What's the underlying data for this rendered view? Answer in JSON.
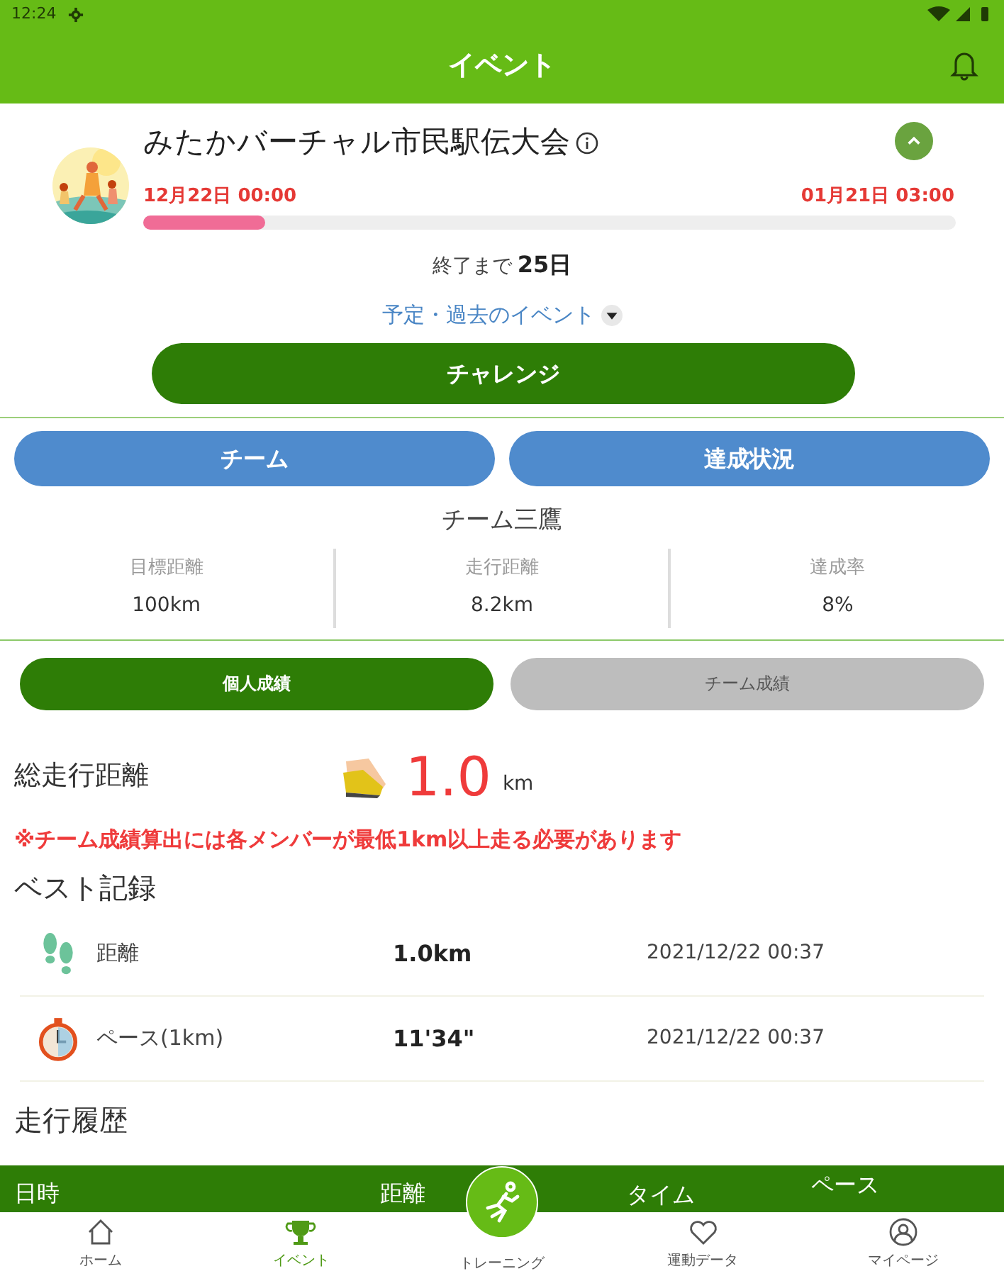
{
  "status_bar": {
    "time": "12:24"
  },
  "app_bar": {
    "title": "イベント"
  },
  "event": {
    "title": "みたかバーチャル市民駅伝大会",
    "expanded": true,
    "start": "12月22日 00:00",
    "end": "01月21日 03:00",
    "level": 0.15,
    "remaining_label": "終了まで",
    "remaining_value": "25日",
    "other_events": "予定・過去のイベント",
    "challenge": "チャレンジ"
  },
  "team_buttons": [
    "チーム",
    "達成状況"
  ],
  "team": {
    "name": "チーム三鷹",
    "stats": [
      {
        "label": "目標距離",
        "value": "100km"
      },
      {
        "label": "走行距離",
        "value": "8.2km"
      },
      {
        "label": "達成率",
        "value": "8%"
      }
    ]
  },
  "result_tabs": [
    {
      "label": "個人成績",
      "selected": true
    },
    {
      "label": "チーム成績",
      "selected": false
    }
  ],
  "total": {
    "label": "総走行距離",
    "value": "1.0",
    "unit": "km"
  },
  "note": "※チーム成績算出には各メンバーが最低1km以上走る必要があります",
  "best": {
    "title": "ベスト記録",
    "rows": [
      {
        "kind": "distance",
        "label": "距離",
        "value": "1.0km",
        "date": "2021/12/22 00:37"
      },
      {
        "kind": "pace",
        "label": "ペース(1km)",
        "value": "11'34\"",
        "date": "2021/12/22 00:37"
      }
    ]
  },
  "history": {
    "title": "走行履歴",
    "columns": [
      "日時",
      "距離",
      "タイム",
      "ペース"
    ]
  },
  "nav": [
    {
      "kind": "home",
      "label": "ホーム",
      "selected": false
    },
    {
      "kind": "event",
      "label": "イベント",
      "selected": true
    },
    {
      "kind": "training",
      "label": "トレーニング",
      "selected": false
    },
    {
      "kind": "data",
      "label": "運動データ",
      "selected": false
    },
    {
      "kind": "mypage",
      "label": "マイページ",
      "selected": false
    }
  ]
}
